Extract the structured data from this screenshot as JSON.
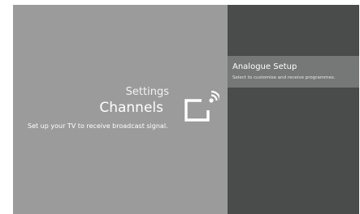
{
  "settings": {
    "breadcrumb": "Settings",
    "title": "Channels",
    "description": "Set up your TV to receive broadcast signal.",
    "icon": "channels-antenna-icon"
  },
  "menu": {
    "items": [
      {
        "label": "Analogue Setup",
        "description": "Select to customise and receive programmes."
      }
    ]
  },
  "colors": {
    "left_panel": "#9b9b9b",
    "right_panel": "#4a4b4b",
    "selected_item": "#767777",
    "text": "#ffffff"
  }
}
